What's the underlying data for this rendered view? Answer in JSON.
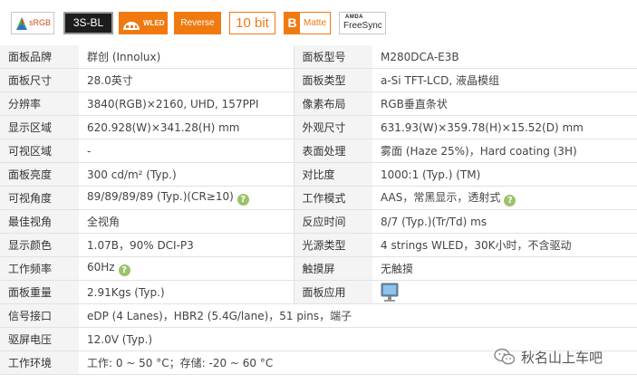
{
  "badges": {
    "srgb": "sRGB",
    "backlight": "3S-BL",
    "wled": "WLED",
    "reverse": "Reverse",
    "bit": "10 bit",
    "matte_mark": "B",
    "matte": "Matte",
    "amd": "AMDA",
    "freesync": "FreeSync"
  },
  "colors": {
    "accent": "#f07a10",
    "label_bg": "#f4f4f4",
    "help_icon": "#9cc26a"
  },
  "rows": [
    {
      "l1": "面板品牌",
      "v1": "群创 (Innolux)",
      "l2": "面板型号",
      "v2": "M280DCA-E3B"
    },
    {
      "l1": "面板尺寸",
      "v1": "28.0英寸",
      "l2": "面板类型",
      "v2": "a-Si TFT-LCD, 液晶模组"
    },
    {
      "l1": "分辨率",
      "v1": "3840(RGB)×2160, UHD, 157PPI",
      "l2": "像素布局",
      "v2": "RGB垂直条状"
    },
    {
      "l1": "显示区域",
      "v1": "620.928(W)×341.28(H) mm",
      "l2": "外观尺寸",
      "v2": "631.93(W)×359.78(H)×15.52(D) mm"
    },
    {
      "l1": "可视区域",
      "v1": "-",
      "l2": "表面处理",
      "v2": "雾面 (Haze 25%)，Hard coating (3H)"
    },
    {
      "l1": "面板亮度",
      "v1": "300 cd/m² (Typ.)",
      "l2": "对比度",
      "v2": "1000:1 (Typ.) (TM)"
    },
    {
      "l1": "可视角度",
      "v1": "89/89/89/89 (Typ.)(CR≥10)",
      "l2": "工作模式",
      "v2": "AAS，常黑显示，透射式"
    },
    {
      "l1": "最佳视角",
      "v1": "全视角",
      "l2": "反应时间",
      "v2": "8/7 (Typ.)(Tr/Td) ms"
    },
    {
      "l1": "显示颜色",
      "v1": "1.07B，90% DCI-P3",
      "l2": "光源类型",
      "v2": "4 strings WLED，30K小时，不含驱动"
    },
    {
      "l1": "工作频率",
      "v1": "60Hz",
      "l2": "触摸屏",
      "v2": "无触摸"
    },
    {
      "l1": "面板重量",
      "v1": "2.91Kgs (Typ.)",
      "l2": "面板应用",
      "v2": ""
    }
  ],
  "wide_rows": [
    {
      "l": "信号接口",
      "v": "eDP (4 Lanes)，HBR2 (5.4G/lane)，51 pins，端子"
    },
    {
      "l": "驱屏电压",
      "v": "12.0V (Typ.)"
    },
    {
      "l": "工作环境",
      "v": "工作: 0 ~ 50 °C；存储: -20 ~ 60 °C"
    }
  ],
  "help_icon_glyph": "?",
  "watermark": "秋名山上车吧"
}
